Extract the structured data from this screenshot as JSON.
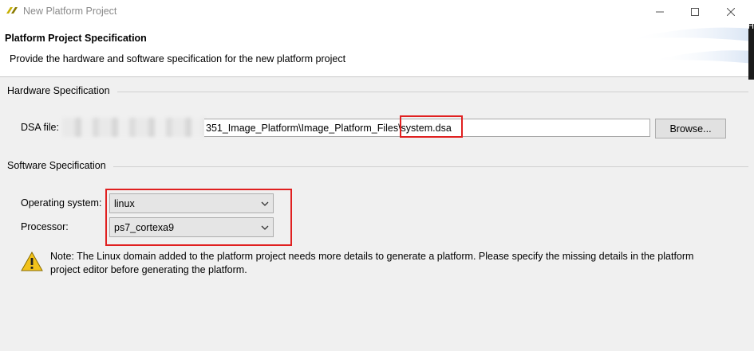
{
  "window": {
    "title": "New Platform Project",
    "minimize_icon": "minimize-icon",
    "maximize_icon": "maximize-icon",
    "close_icon": "close-icon",
    "side_char": "H"
  },
  "header": {
    "title": "Platform Project Specification",
    "description": "Provide the hardware and software specification for the new platform project"
  },
  "hardware": {
    "group_label": "Hardware Specification",
    "dsa_label": "DSA file:",
    "dsa_value": "351_Image_Platform\\Image_Platform_Files\\system.dsa",
    "browse_label": "Browse..."
  },
  "software": {
    "group_label": "Software Specification",
    "os_label": "Operating system:",
    "os_value": "linux",
    "processor_label": "Processor:",
    "processor_value": "ps7_cortexa9"
  },
  "note": {
    "icon": "warning-icon",
    "text": "Note: The Linux domain added to the platform project needs more details to generate a platform. Please specify the missing details in the platform project editor before generating the platform."
  },
  "colors": {
    "highlight": "#e02020",
    "warning": "#f2c21b"
  }
}
